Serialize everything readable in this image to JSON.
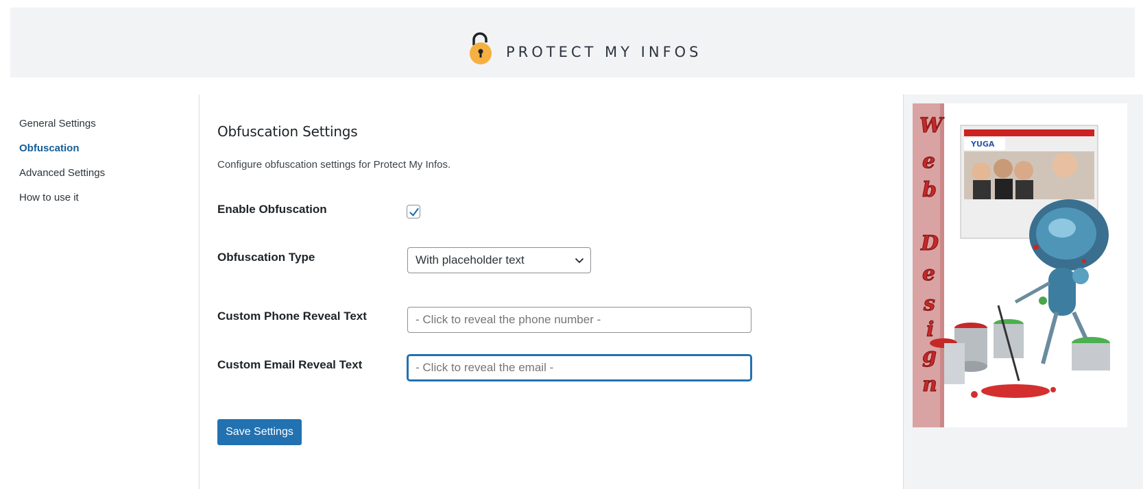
{
  "header": {
    "logo_text": "PROTECT MY INFOS",
    "logo_icon": "padlock-icon",
    "accent_color": "#f5b040"
  },
  "sidebar": {
    "items": [
      {
        "label": "General Settings",
        "active": false
      },
      {
        "label": "Obfuscation",
        "active": true
      },
      {
        "label": "Advanced Settings",
        "active": false
      },
      {
        "label": "How to use it",
        "active": false
      }
    ]
  },
  "main": {
    "title": "Obfuscation Settings",
    "description": "Configure obfuscation settings for Protect My Infos.",
    "enable_label": "Enable Obfuscation",
    "enable_checked": true,
    "type_label": "Obfuscation Type",
    "type_value": "With placeholder text",
    "phone_label": "Custom Phone Reveal Text",
    "phone_placeholder": "- Click to reveal the phone number -",
    "email_label": "Custom Email Reveal Text",
    "email_placeholder": "- Click to reveal the email -",
    "save_label": "Save Settings"
  },
  "ad": {
    "vertical_text": "Web Design",
    "site_logo": "YUGA"
  },
  "colors": {
    "primary": "#2271b1",
    "active_link": "#135e96",
    "header_bg": "#f2f3f5"
  }
}
